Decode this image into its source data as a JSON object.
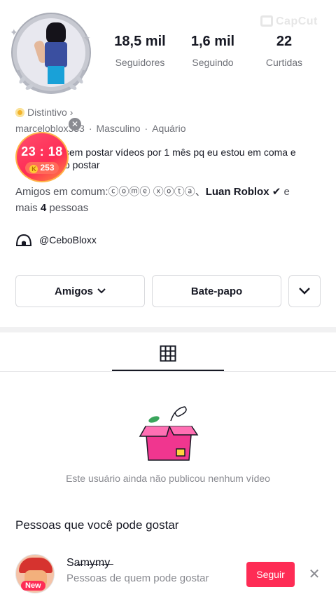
{
  "watermark": "CapCut",
  "profile": {
    "avatar_icon": "roblox-avatar",
    "stats": [
      {
        "value": "18,5 mil",
        "label": "Seguidores"
      },
      {
        "value": "1,6 mil",
        "label": "Seguindo"
      },
      {
        "value": "22",
        "label": "Curtidas"
      }
    ],
    "badge_label": "Distintivo",
    "username": "marceloblox333",
    "gender": "Masculino",
    "sign": "Aquário",
    "bio": "sem postar vídeos por 1 mês pq eu estou em coma e ... sem postar vídeos por 1 mês pq eu estou em coma e o postar",
    "bio_line1": "sem postar vídeos por 1 mês pq eu estou em coma e",
    "bio_line2": "o postar",
    "mutual_prefix": "Amigos em comum:",
    "mutual_name1": "ⓒⓞⓜⓔ ⓧⓞⓣⓐ",
    "mutual_sep": "、",
    "mutual_name2": "Luan Roblox ✔",
    "mutual_and": " e",
    "mutual_more_prefix": "mais ",
    "mutual_more_count": "4",
    "mutual_more_suffix": " pessoas",
    "social_handle": "@CeboBloxx"
  },
  "timer": {
    "time": "23 : 18",
    "coins": "253"
  },
  "buttons": {
    "friends": "Amigos",
    "chat": "Bate-papo"
  },
  "tabs": {
    "active_icon": "grid-icon"
  },
  "empty_state": {
    "text": "Este usuário ainda não publicou nenhum vídeo"
  },
  "suggestions": {
    "title": "Pessoas que você pode gostar",
    "items": [
      {
        "name": "Sa̶m̶y̶m̶y̶",
        "subtitle": "Pessoas de quem pode gostar",
        "tag": "New",
        "follow_label": "Seguir"
      }
    ]
  },
  "colors": {
    "accent": "#fe2c55",
    "text": "#161823",
    "muted": "#8a8b91"
  }
}
